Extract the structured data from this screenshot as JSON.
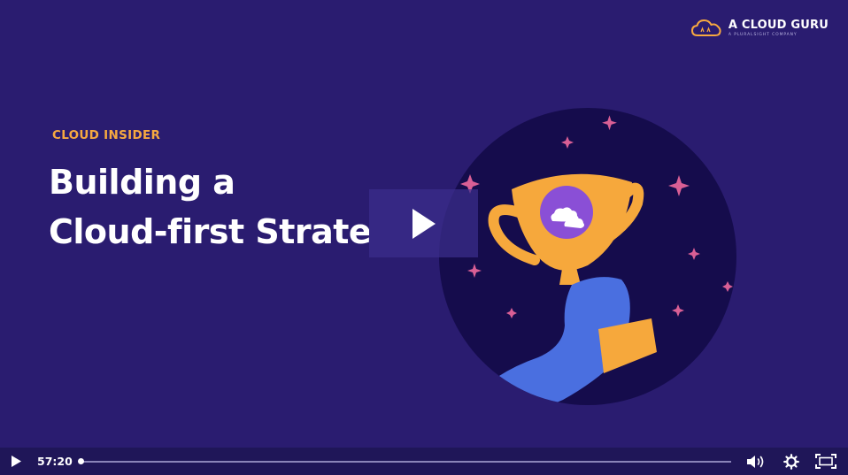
{
  "brand": {
    "name": "A CLOUD GURU",
    "tagline": "A PLURALSIGHT COMPANY",
    "logo_icon": "cloud-logo-icon",
    "accent": "#f7a940"
  },
  "slide": {
    "eyebrow": "CLOUD INSIDER",
    "title_line1": "Building a",
    "title_line2": "Cloud-first Strategy",
    "background": "#2a1c70",
    "illustration": "trophy-in-hand-icon"
  },
  "player": {
    "play_overlay_icon": "play-icon",
    "play_button_icon": "play-icon",
    "time": "57:20",
    "progress": 0.0,
    "volume_icon": "volume-icon",
    "settings_icon": "gear-icon",
    "fullscreen_icon": "fullscreen-icon"
  }
}
